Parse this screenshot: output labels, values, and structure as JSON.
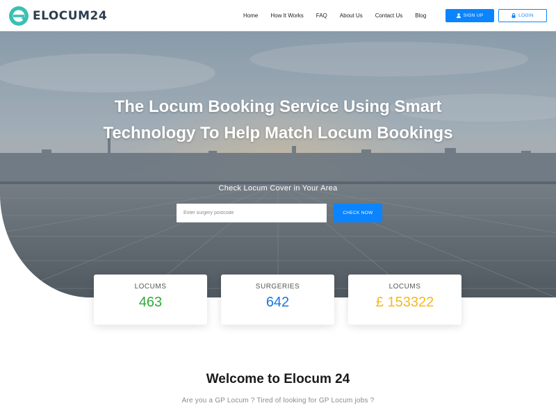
{
  "header": {
    "logo_text": "ELOCUM24",
    "logo_icon": "e-logo-icon",
    "nav": [
      {
        "label": "Home"
      },
      {
        "label": "How It Works"
      },
      {
        "label": "FAQ"
      },
      {
        "label": "About Us"
      },
      {
        "label": "Contact Us"
      },
      {
        "label": "Blog"
      }
    ],
    "signup": {
      "label": "SIGN UP",
      "icon": "user-icon"
    },
    "login": {
      "label": "LOGIN",
      "icon": "lock-icon"
    }
  },
  "hero": {
    "title": "The Locum Booking Service Using Smart Technology To Help Match Locum Bookings",
    "subtitle": "Check Locum Cover in Your Area",
    "search": {
      "placeholder": "Enter surgery postcode",
      "value": ""
    },
    "check_button": "CHECK NOW"
  },
  "stats": [
    {
      "label": "LOCUMS",
      "value": "463",
      "color": "#2eaa3b"
    },
    {
      "label": "SURGERIES",
      "value": "642",
      "color": "#1976e0"
    },
    {
      "label": "LOCUMS",
      "value": "£ 153322",
      "color": "#f5b820"
    }
  ],
  "welcome": {
    "title": "Welcome to Elocum 24",
    "subtitle": "Are you a GP Locum ? Tired of looking for GP Locum jobs ?"
  },
  "colors": {
    "primary": "#0a84ff",
    "logo_teal": "#3bbfb4",
    "logo_text": "#2c3e50"
  }
}
